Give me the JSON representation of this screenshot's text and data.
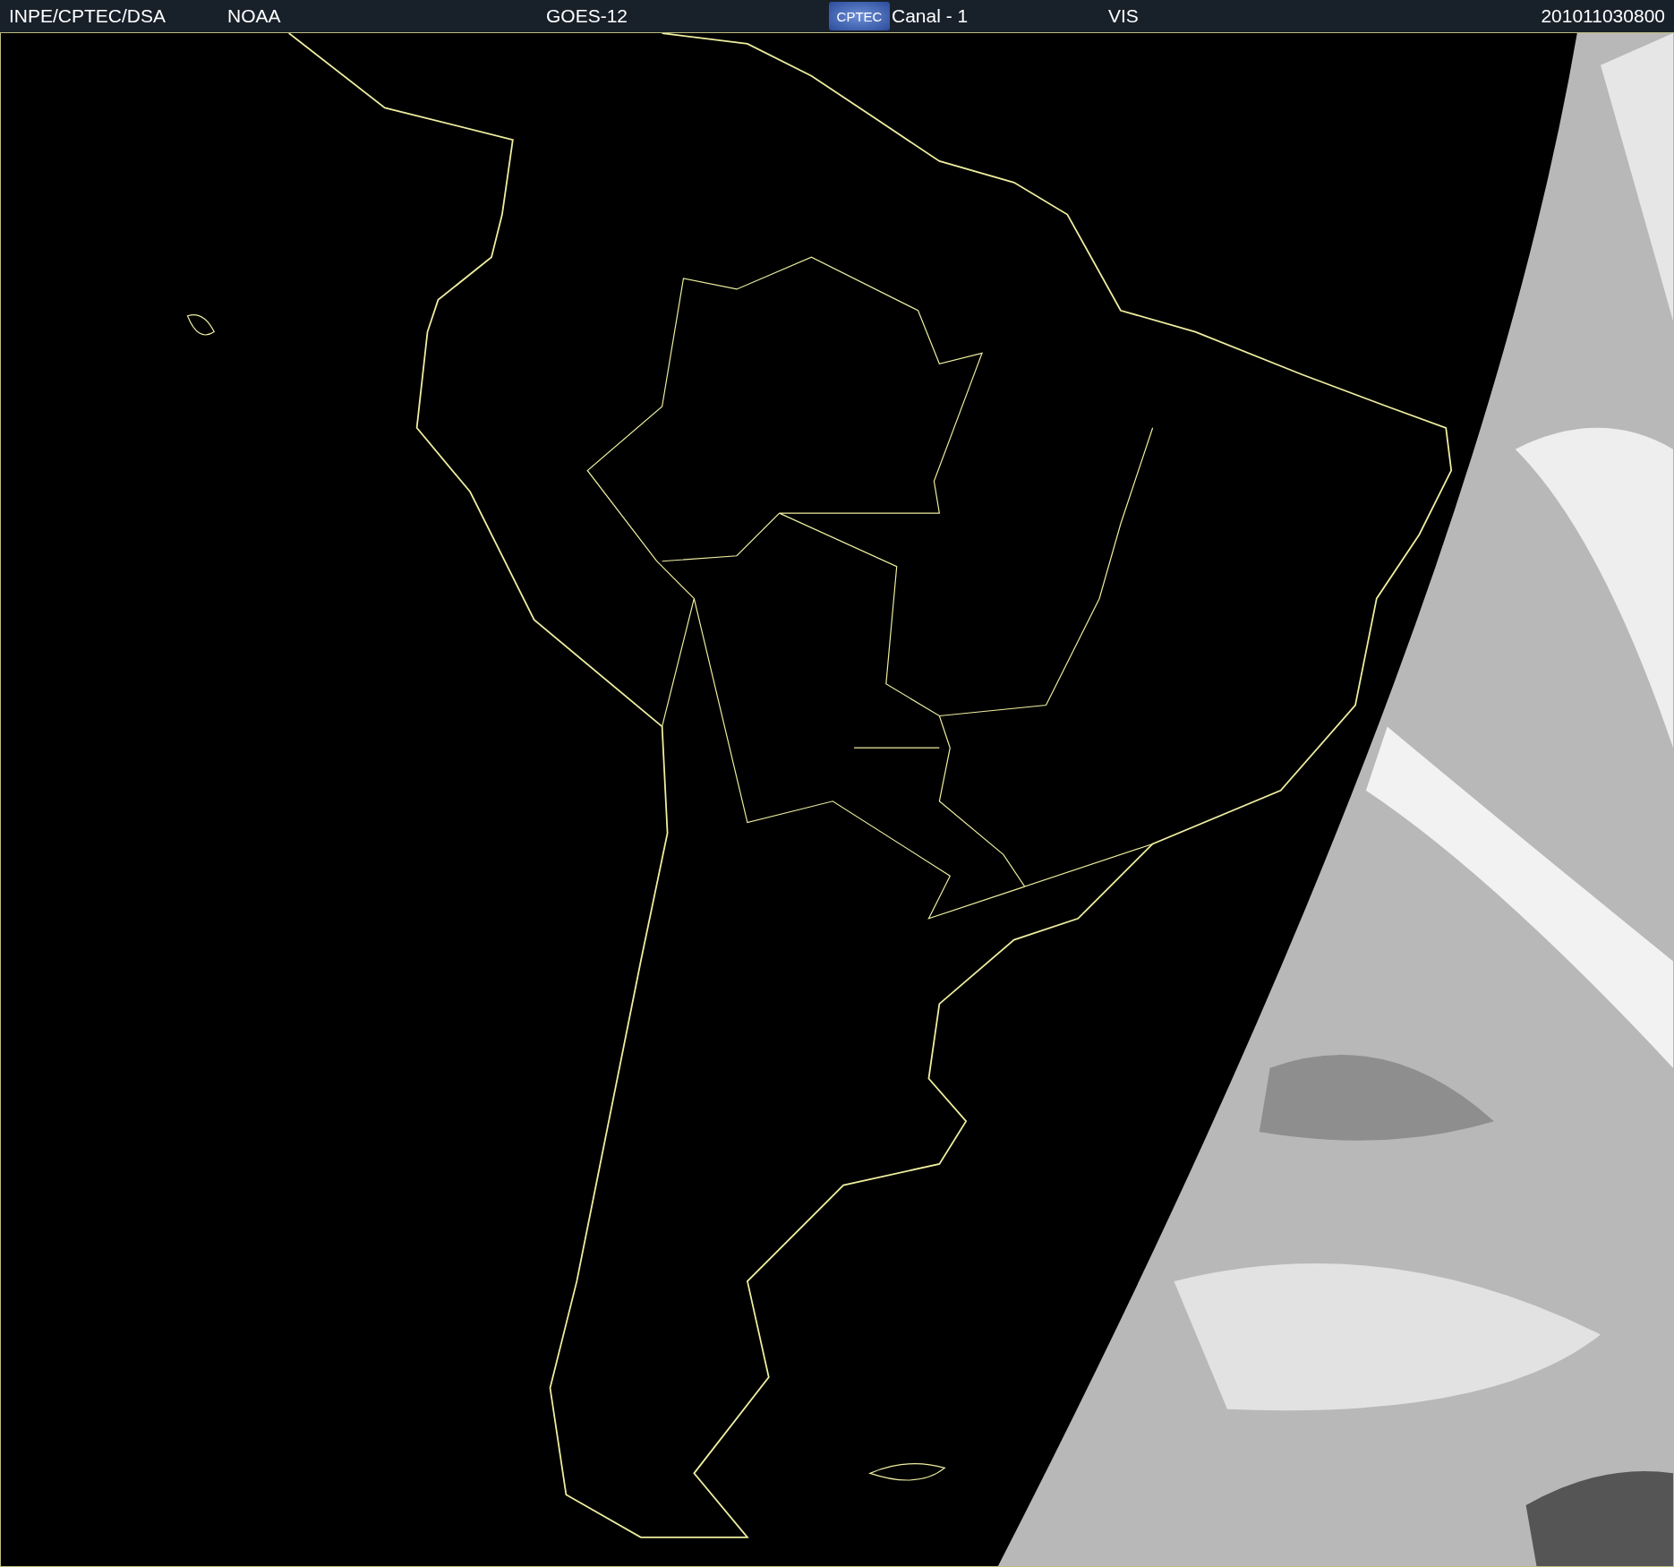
{
  "header": {
    "source": "INPE/CPTEC/DSA",
    "agency": "NOAA",
    "satellite": "GOES-12",
    "logo": "CPTEC",
    "channel": "Canal - 1",
    "band": "VIS",
    "timestamp": "201011030800"
  }
}
